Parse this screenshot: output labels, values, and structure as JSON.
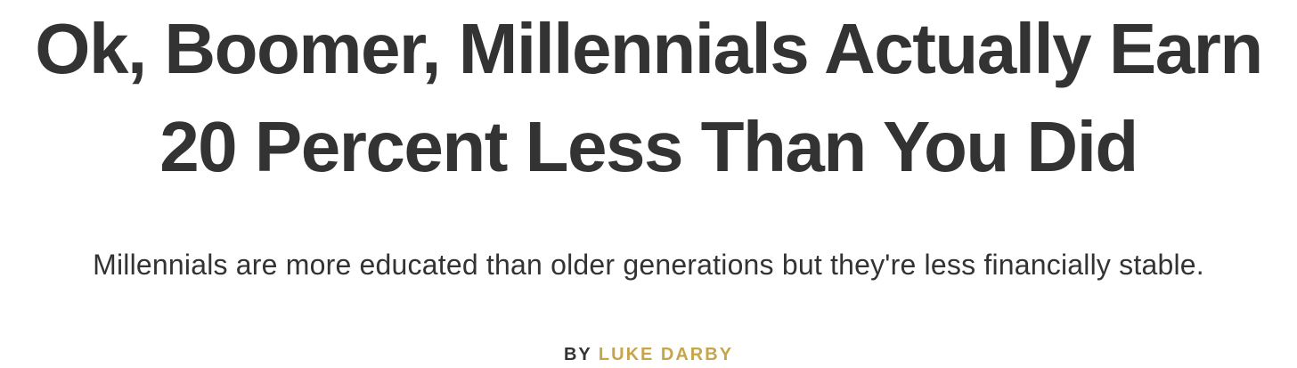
{
  "article": {
    "headline": {
      "line1": "Ok, Boomer, Millennials Actually Earn",
      "line2": "20 Percent Less Than You Did"
    },
    "dek": "Millennials are more educated than older generations but they're less financially stable.",
    "byline": {
      "prefix": "BY",
      "author": "LUKE DARBY"
    }
  },
  "colors": {
    "text": "#333333",
    "author_accent": "#c7a54a",
    "background": "#ffffff"
  }
}
